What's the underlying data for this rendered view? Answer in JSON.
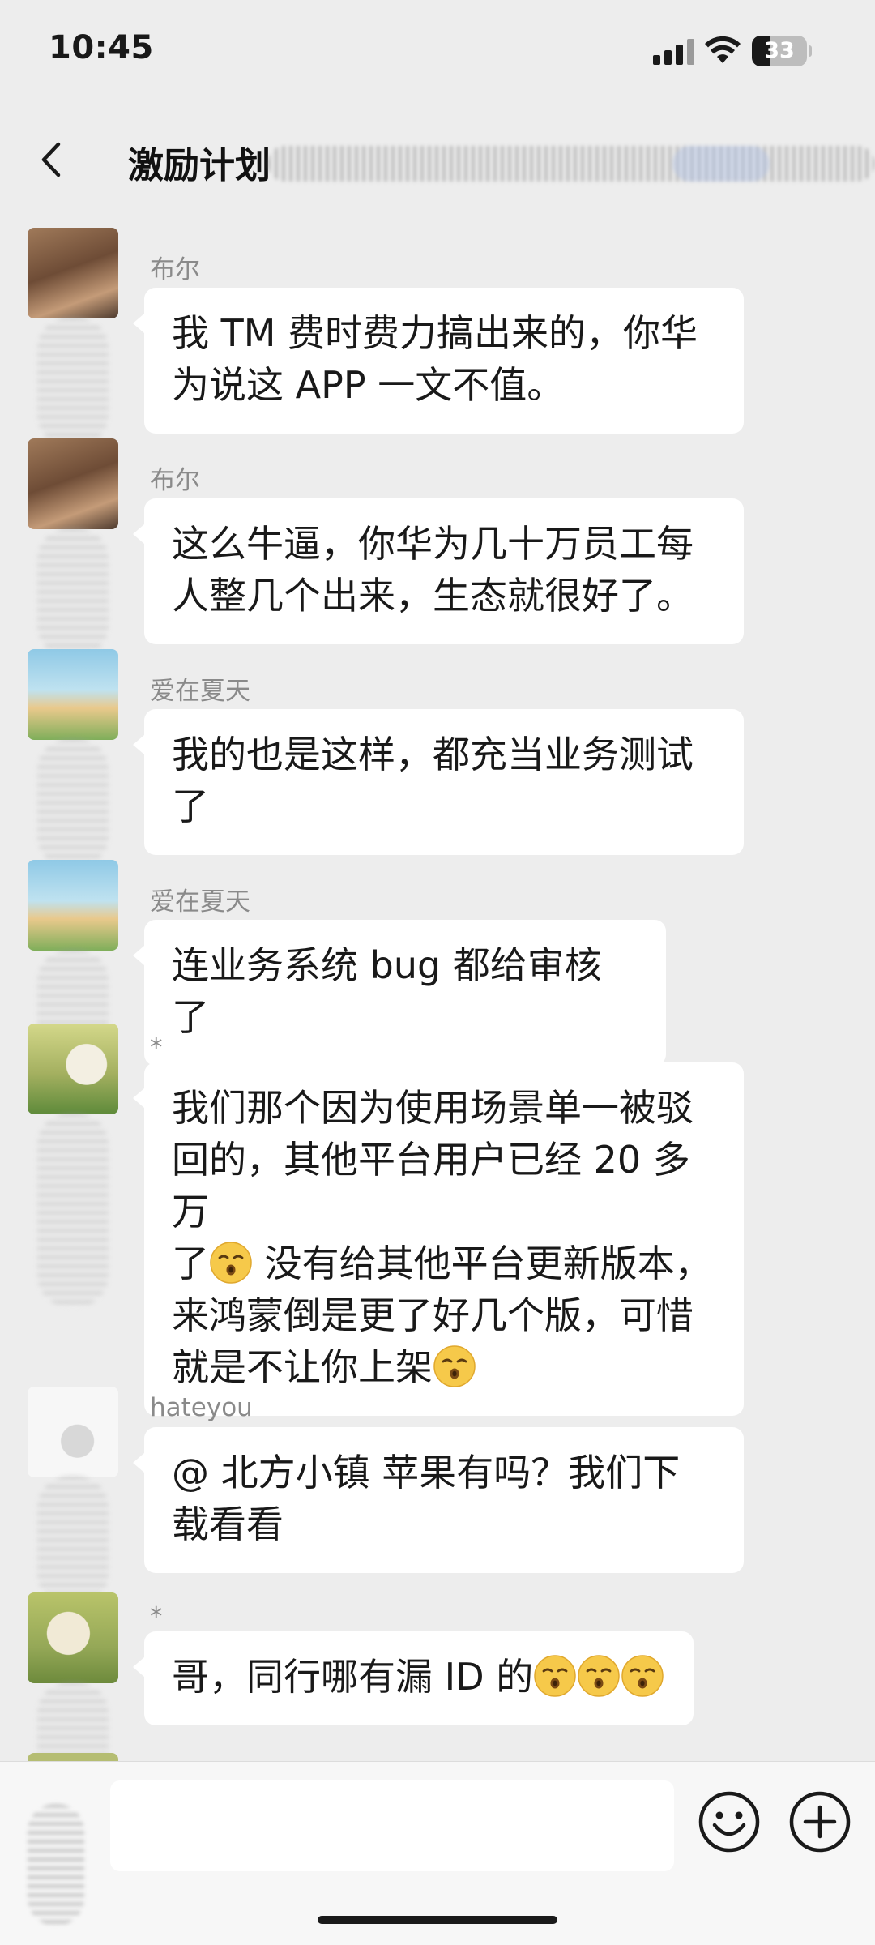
{
  "status_bar": {
    "time": "10:45",
    "battery_level": "33",
    "battery_fraction": 0.33,
    "icons": [
      "signal-icon",
      "wifi-icon",
      "battery-icon"
    ]
  },
  "header": {
    "title": "激励计划",
    "back_icon": "chevron-left-icon"
  },
  "messages": [
    {
      "sender": "布尔",
      "text": "我 TM 费时费力搞出来的，你华\n为说这 APP 一文不值。"
    },
    {
      "sender": "布尔",
      "text": "这么牛逼，你华为几十万员工每\n人整几个出来，生态就很好了。"
    },
    {
      "sender": "爱在夏天",
      "text": "我的也是这样，都充当业务测试\n了"
    },
    {
      "sender": "爱在夏天",
      "text": "连业务系统 bug 都给审核了"
    },
    {
      "sender": "*",
      "text_line1": "我们那个因为使用场景单一被驳",
      "text_line2": "回的，其他平台用户已经 20 多万",
      "text_line3a": "了",
      "text_line3b": " 没有给其他平台更新版本，",
      "text_line4": "来鸿蒙倒是更了好几个版，可惜",
      "text_line5": "就是不让你上架"
    },
    {
      "sender": "hateyou",
      "text": "@ 北方小镇  苹果有吗？我们下\n载看看"
    },
    {
      "sender": "*",
      "text": "哥，同行哪有漏 ID 的"
    }
  ],
  "emoji_name": "kissing-face-icon",
  "input_bar": {
    "placeholder": "",
    "value": "",
    "icons": [
      "voice-icon",
      "emoji-icon",
      "plus-icon"
    ]
  },
  "colors": {
    "background": "#ededed",
    "bubble": "#ffffff",
    "sender_name": "#8a8a8a",
    "text": "#191919"
  }
}
